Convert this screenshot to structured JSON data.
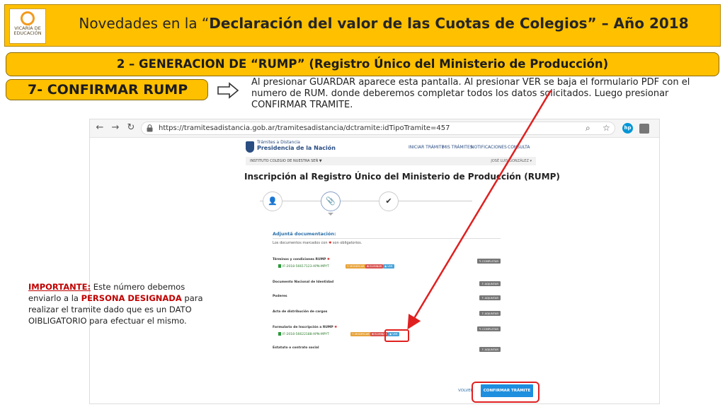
{
  "slide": {
    "logo_text": [
      "VICARÍA DE",
      "EDUCACIÓN"
    ],
    "title_plain": "Novedades en la “",
    "title_bold": "Declaración del valor de las Cuotas de Colegios” – Año 2018",
    "subtitle": "2 – GENERACION DE “RUMP” (Registro Único del Ministerio de Producción)",
    "step_label": "7- CONFIRMAR RUMP",
    "description": "Al presionar GUARDAR aparece esta pantalla. Al presionar VER se baja el formulario PDF con el numero de RUM.  donde deberemos completar todos los datos solicitados. Luego presionar CONFIRMAR TRAMITE.",
    "important": {
      "label": "IMPORTANTE:",
      "text_before": " Este número debemos enviarlo a la ",
      "strong": "PERSONA DESIGNADA",
      "text_after": " para realizar el tramite dado que es un DATO OIBLIGATORIO para efectuar el mismo."
    },
    "colors": {
      "banner": "#ffc000",
      "highlight": "#e02020"
    }
  },
  "browser": {
    "url": "https://tramitesadistancia.gob.ar/tramitesadistancia/dctramite:idTipoTramite=457",
    "hp_label": "hp"
  },
  "site": {
    "brand_top": "Trámites a Distancia",
    "brand_main": "Presidencia de la Nación",
    "nav": [
      "INICIAR TRÁMITE",
      "MIS TRÁMITES",
      "NOTIFICACIONES",
      "CONSULTA"
    ],
    "user_org": "INSTITUTO COLEGIO DE NUESTRA SEÑ ▼",
    "user_name": "JOSÉ LUIS GONZÁLEZ ▾",
    "heading": "Inscripción al Registro Único del Ministerio de Producción (RUMP)",
    "steps": [
      {
        "icon": "user-icon",
        "glyph": "👤"
      },
      {
        "icon": "paperclip-icon",
        "glyph": "📎"
      },
      {
        "icon": "check-icon",
        "glyph": "✔"
      }
    ],
    "documents": {
      "title": "Adjuntá documentación:",
      "note_before": "Los documentos marcados con ",
      "note_after": " son obligatorios.",
      "rows": [
        {
          "name": "Términos y condiciones RUMP",
          "required": true,
          "file": "IF-2018-56617123-APN-MPYT",
          "action": "✎ COMPLETAR",
          "has_file": true
        },
        {
          "name": "Documento Nacional de Identidad",
          "required": false,
          "file": "",
          "action": "⇪ ADJUNTAR",
          "has_file": false
        },
        {
          "name": "Poderes",
          "required": false,
          "file": "",
          "action": "⇪ ADJUNTAR",
          "has_file": false
        },
        {
          "name": "Acta de distribución de cargos",
          "required": false,
          "file": "",
          "action": "⇪ ADJUNTAR",
          "has_file": false
        },
        {
          "name": "Formulario de Inscripción a RUMP",
          "required": true,
          "file": "IF-2018-56622188-APN-MPYT",
          "action": "✎ COMPLETAR",
          "has_file": true
        },
        {
          "name": "Estatuto o contrato social",
          "required": false,
          "file": "",
          "action": "⇪ ADJUNTAR",
          "has_file": false
        }
      ],
      "file_buttons": {
        "modify": "✎ MODIFICAR",
        "delete": "✖ ELIMINAR",
        "view": "◉ VER"
      }
    },
    "back_label": "VOLVER",
    "confirm_label": "CONFIRMAR TRÁMITE"
  }
}
